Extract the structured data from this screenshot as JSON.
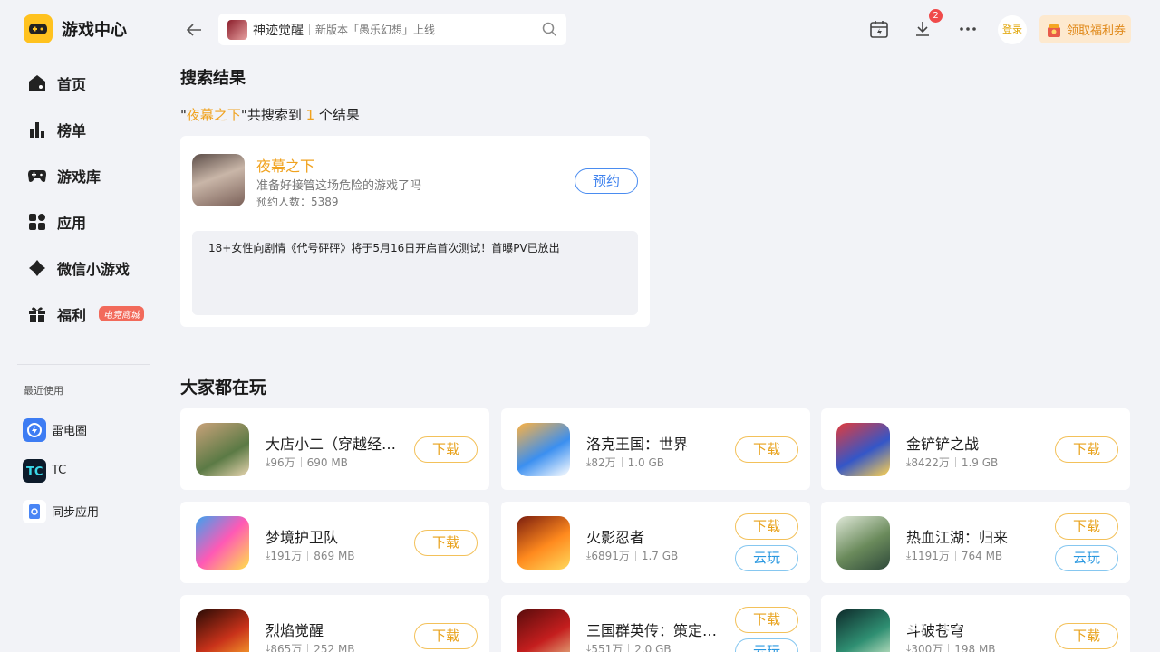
{
  "brand": {
    "title": "游戏中心",
    "logo_icon": "gamepad-icon",
    "accent": "#ffc21f"
  },
  "sidebar": {
    "items": [
      {
        "label": "首页",
        "icon": "home-icon"
      },
      {
        "label": "榜单",
        "icon": "ranking-icon"
      },
      {
        "label": "游戏库",
        "icon": "gamepad-icon"
      },
      {
        "label": "应用",
        "icon": "apps-icon"
      },
      {
        "label": "微信小游戏",
        "icon": "minigame-icon"
      },
      {
        "label": "福利",
        "icon": "gift-icon",
        "badge": "电竞商城"
      }
    ],
    "recent_title": "最近使用",
    "recent": [
      {
        "label": "雷电圈",
        "icon": "leidian-circle-icon"
      },
      {
        "label": "TC",
        "icon": "tc-icon"
      },
      {
        "label": "同步应用",
        "icon": "sync-app-icon"
      }
    ]
  },
  "topbar": {
    "search_keyword": "神迹觉醒",
    "search_placeholder": "新版本「愚乐幻想」上线",
    "download_badge": "2",
    "login_label": "登录",
    "coupon_label": "领取福利券"
  },
  "results": {
    "title": "搜索结果",
    "summary_prefix": "\"",
    "summary_keyword": "夜幕之下",
    "summary_middle": "\"共搜索到 ",
    "summary_count": "1",
    "summary_suffix": " 个结果",
    "item": {
      "name": "夜幕之下",
      "desc": "准备好接管这场危险的游戏了吗",
      "count": "预约人数：5389",
      "button": "预约",
      "news": "18+女性向剧情《代号砰砰》将于5月16日开启首次测试！首曝PV已放出"
    }
  },
  "popular": {
    "title": "大家都在玩",
    "download_label": "下载",
    "cloud_label": "云玩",
    "games": [
      {
        "name": "大店小二（穿越经营）",
        "downloads": "96万",
        "size": "690 MB",
        "cloud": false
      },
      {
        "name": "洛克王国：世界",
        "downloads": "82万",
        "size": "1.0 GB",
        "cloud": false
      },
      {
        "name": "金铲铲之战",
        "downloads": "8422万",
        "size": "1.9 GB",
        "cloud": false
      },
      {
        "name": "梦境护卫队",
        "downloads": "191万",
        "size": "869 MB",
        "cloud": false
      },
      {
        "name": "火影忍者",
        "downloads": "6891万",
        "size": "1.7 GB",
        "cloud": true
      },
      {
        "name": "热血江湖：归来",
        "downloads": "1191万",
        "size": "764 MB",
        "cloud": true
      },
      {
        "name": "烈焰觉醒",
        "downloads": "865万",
        "size": "252 MB",
        "cloud": false
      },
      {
        "name": "三国群英传：策定九州",
        "downloads": "551万",
        "size": "2.0 GB",
        "cloud": true
      },
      {
        "name": "斗破苍穹",
        "downloads": "300万",
        "size": "198 MB",
        "cloud": false
      }
    ]
  },
  "watermark": "雷电模拟器"
}
